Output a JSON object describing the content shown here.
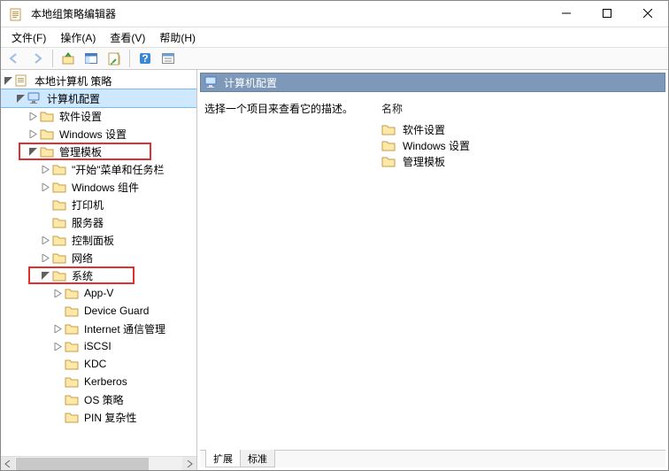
{
  "window": {
    "title": "本地组策略编辑器"
  },
  "menu": {
    "file": "文件(F)",
    "action": "操作(A)",
    "view": "查看(V)",
    "help": "帮助(H)"
  },
  "tree": {
    "root": "本地计算机 策略",
    "computer_cfg": "计算机配置",
    "software_settings": "软件设置",
    "windows_settings": "Windows 设置",
    "admin_templates": "管理模板",
    "start_taskbar": "\"开始\"菜单和任务栏",
    "windows_components": "Windows 组件",
    "printers": "打印机",
    "servers": "服务器",
    "control_panel": "控制面板",
    "network": "网络",
    "system": "系统",
    "app_v": "App-V",
    "device_guard": "Device Guard",
    "internet_comm": "Internet 通信管理",
    "iscsi": "iSCSI",
    "kdc": "KDC",
    "kerberos": "Kerberos",
    "os_policy": "OS 策略",
    "pin_complexity": "PIN 复杂性"
  },
  "content": {
    "header": "计算机配置",
    "hint": "选择一个项目来查看它的描述。",
    "col_name": "名称",
    "items": {
      "0": "软件设置",
      "1": "Windows 设置",
      "2": "管理模板"
    }
  },
  "tabs": {
    "extended": "扩展",
    "standard": "标准"
  }
}
